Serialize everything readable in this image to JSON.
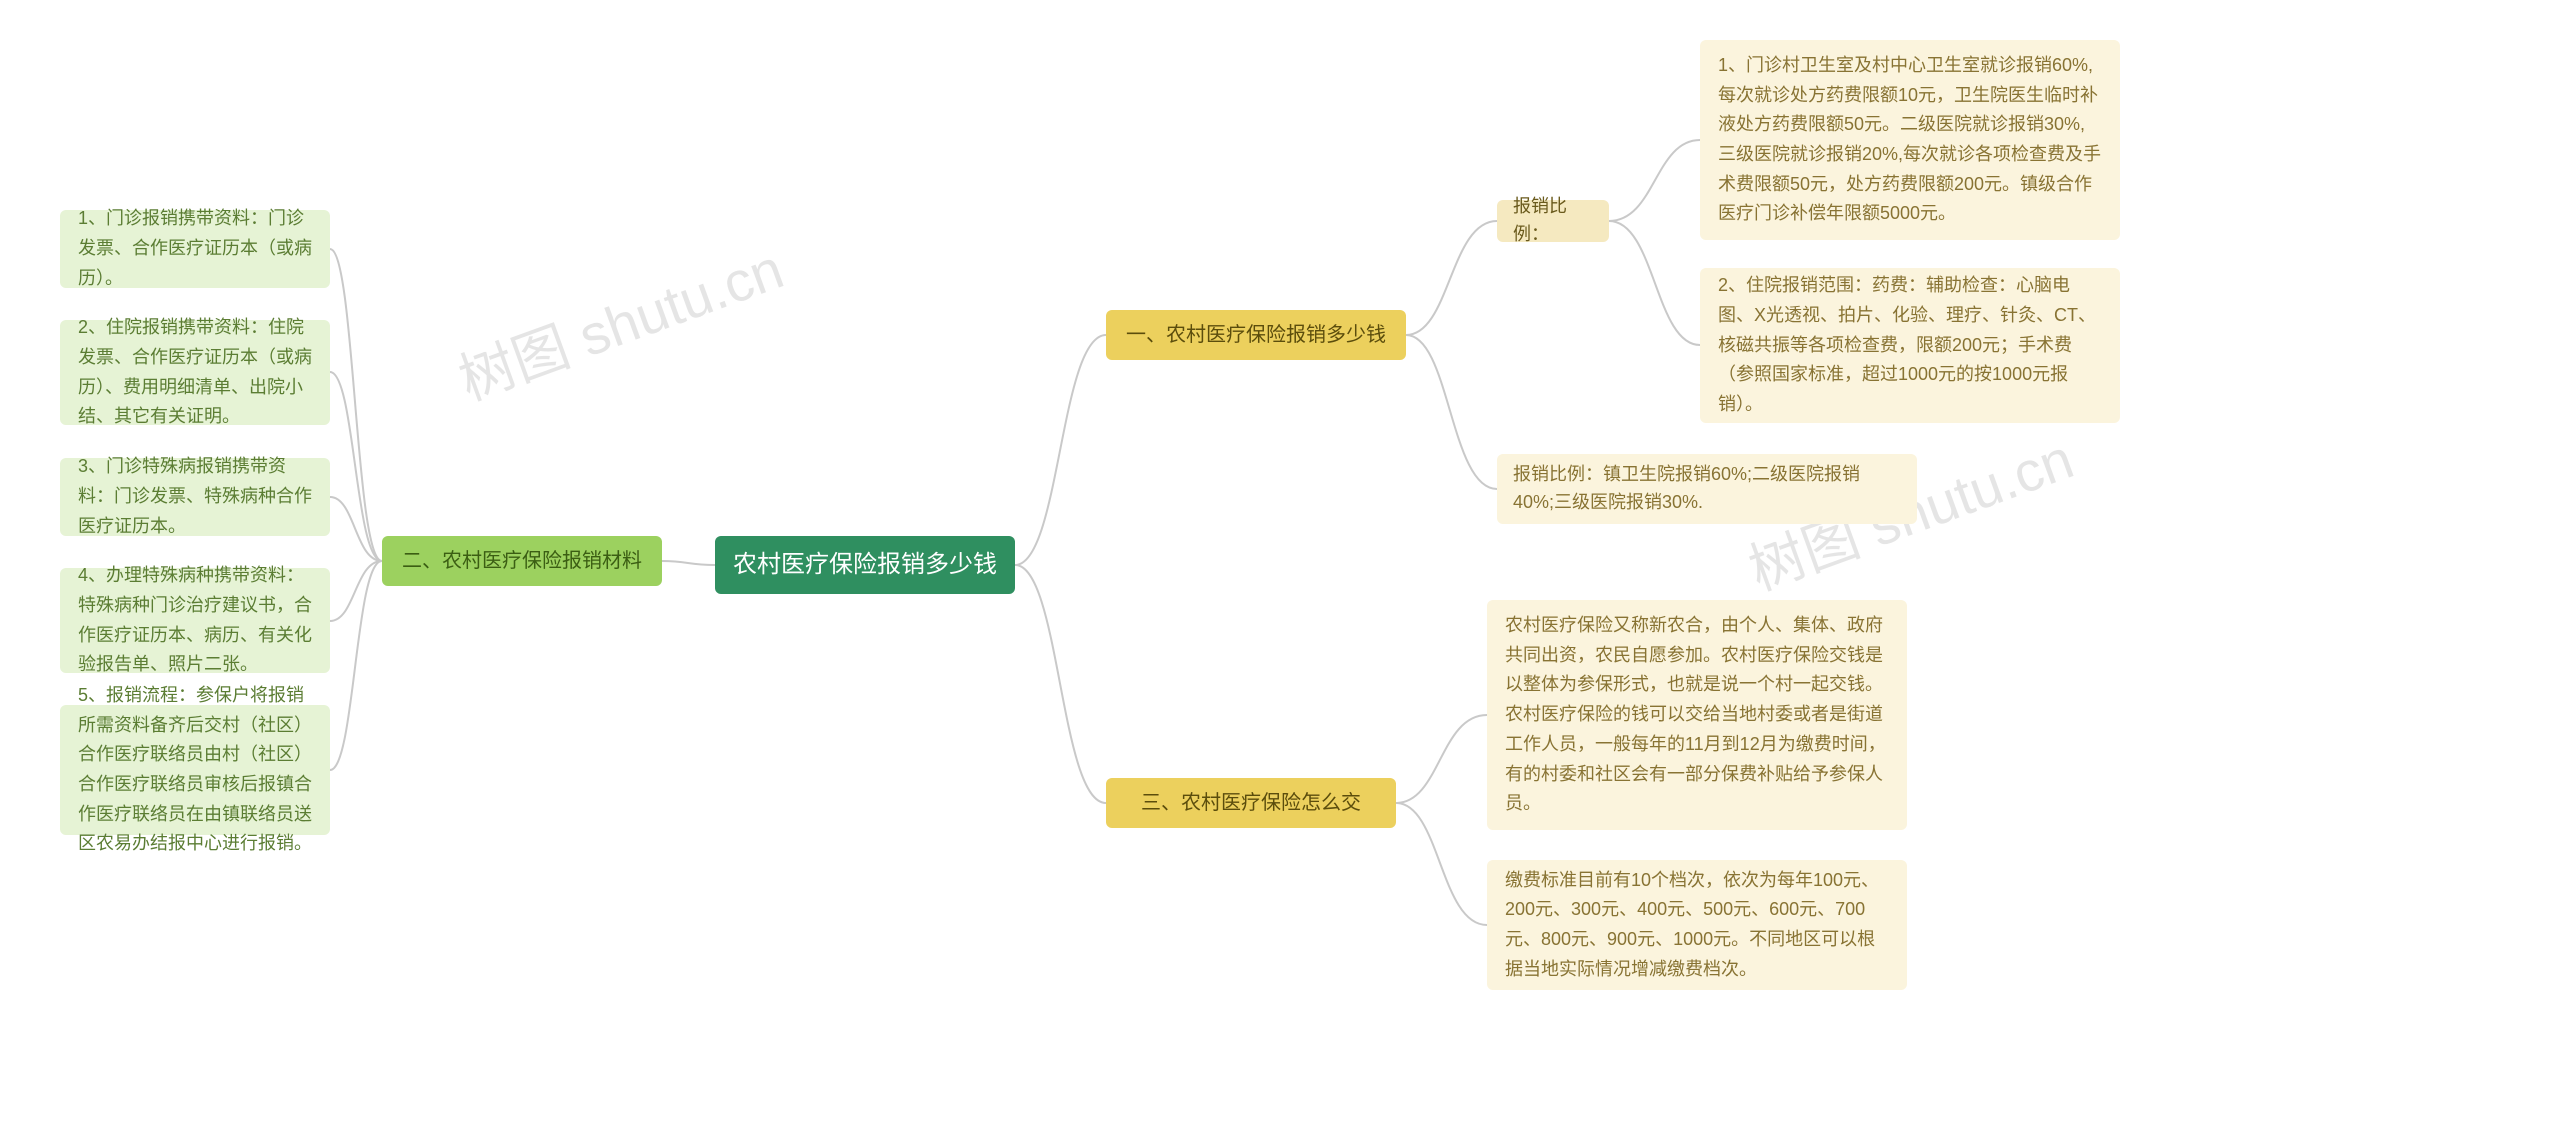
{
  "watermark": "树图 shutu.cn",
  "root": {
    "title": "农村医疗保险报销多少钱"
  },
  "branch1": {
    "title": "一、农村医疗保险报销多少钱",
    "ratio_label": "报销比例：",
    "leaf1": "1、门诊村卫生室及村中心卫生室就诊报销60%,每次就诊处方药费限额10元，卫生院医生临时补液处方药费限额50元。二级医院就诊报销30%,三级医院就诊报销20%,每次就诊各项检查费及手术费限额50元，处方药费限额200元。镇级合作医疗门诊补偿年限额5000元。",
    "leaf2": "2、住院报销范围：药费：辅助检查：心脑电图、X光透视、拍片、化验、理疗、针灸、CT、核磁共振等各项检查费，限额200元；手术费（参照国家标准，超过1000元的按1000元报销）。",
    "leaf3": "报销比例：镇卫生院报销60%;二级医院报销40%;三级医院报销30%."
  },
  "branch2": {
    "title": "二、农村医疗保险报销材料",
    "leaf1": "1、门诊报销携带资料：门诊发票、合作医疗证历本（或病历）。",
    "leaf2": "2、住院报销携带资料：住院发票、合作医疗证历本（或病历）、费用明细清单、出院小结、其它有关证明。",
    "leaf3": "3、门诊特殊病报销携带资料：门诊发票、特殊病种合作医疗证历本。",
    "leaf4": "4、办理特殊病种携带资料：特殊病种门诊治疗建议书，合作医疗证历本、病历、有关化验报告单、照片二张。",
    "leaf5": "5、报销流程：参保户将报销所需资料备齐后交村（社区）合作医疗联络员由村（社区）合作医疗联络员审核后报镇合作医疗联络员在由镇联络员送区农易办结报中心进行报销。"
  },
  "branch3": {
    "title": "三、农村医疗保险怎么交",
    "leaf1": "农村医疗保险又称新农合，由个人、集体、政府共同出资，农民自愿参加。农村医疗保险交钱是以整体为参保形式，也就是说一个村一起交钱。农村医疗保险的钱可以交给当地村委或者是街道工作人员，一般每年的11月到12月为缴费时间，有的村委和社区会有一部分保费补贴给予参保人员。",
    "leaf2": "缴费标准目前有10个档次，依次为每年100元、200元、300元、400元、500元、600元、700元、800元、900元、1000元。不同地区可以根据当地实际情况增减缴费档次。"
  },
  "chart_data": {
    "type": "mindmap",
    "root": "农村医疗保险报销多少钱",
    "children": [
      {
        "label": "一、农村医疗保险报销多少钱",
        "children": [
          {
            "label": "报销比例：",
            "children": [
              {
                "label": "1、门诊村卫生室及村中心卫生室就诊报销60%,每次就诊处方药费限额10元，卫生院医生临时补液处方药费限额50元。二级医院就诊报销30%,三级医院就诊报销20%,每次就诊各项检查费及手术费限额50元，处方药费限额200元。镇级合作医疗门诊补偿年限额5000元。"
              },
              {
                "label": "2、住院报销范围：药费：辅助检查：心脑电图、X光透视、拍片、化验、理疗、针灸、CT、核磁共振等各项检查费，限额200元；手术费（参照国家标准，超过1000元的按1000元报销）。"
              }
            ]
          },
          {
            "label": "报销比例：镇卫生院报销60%;二级医院报销40%;三级医院报销30%."
          }
        ]
      },
      {
        "label": "二、农村医疗保险报销材料",
        "children": [
          {
            "label": "1、门诊报销携带资料：门诊发票、合作医疗证历本（或病历）。"
          },
          {
            "label": "2、住院报销携带资料：住院发票、合作医疗证历本（或病历）、费用明细清单、出院小结、其它有关证明。"
          },
          {
            "label": "3、门诊特殊病报销携带资料：门诊发票、特殊病种合作医疗证历本。"
          },
          {
            "label": "4、办理特殊病种携带资料：特殊病种门诊治疗建议书，合作医疗证历本、病历、有关化验报告单、照片二张。"
          },
          {
            "label": "5、报销流程：参保户将报销所需资料备齐后交村（社区）合作医疗联络员由村（社区）合作医疗联络员审核后报镇合作医疗联络员在由镇联络员送区农易办结报中心进行报销。"
          }
        ]
      },
      {
        "label": "三、农村医疗保险怎么交",
        "children": [
          {
            "label": "农村医疗保险又称新农合，由个人、集体、政府共同出资，农民自愿参加。农村医疗保险交钱是以整体为参保形式，也就是说一个村一起交钱。农村医疗保险的钱可以交给当地村委或者是街道工作人员，一般每年的11月到12月为缴费时间，有的村委和社区会有一部分保费补贴给予参保人员。"
          },
          {
            "label": "缴费标准目前有10个档次，依次为每年100元、200元、300元、400元、500元、600元、700元、800元、900元、1000元。不同地区可以根据当地实际情况增减缴费档次。"
          }
        ]
      }
    ]
  }
}
